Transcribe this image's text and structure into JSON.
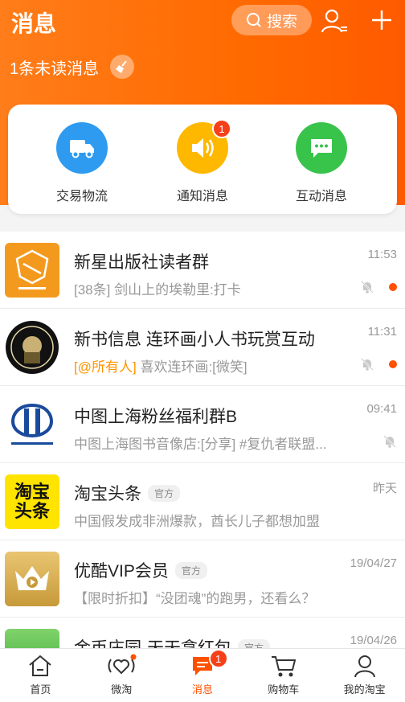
{
  "header": {
    "title": "消息",
    "search_label": "搜索",
    "unread_text": "1条未读消息",
    "brand_color": "#ff6a00"
  },
  "categories": [
    {
      "label": "交易物流",
      "icon": "truck-icon",
      "color": "#2e9bf0"
    },
    {
      "label": "通知消息",
      "icon": "speaker-icon",
      "color": "#ffb800",
      "badge": "1"
    },
    {
      "label": "互动消息",
      "icon": "chat-icon",
      "color": "#38c34b"
    }
  ],
  "messages": [
    {
      "name": "新星出版社读者群",
      "time": "11:53",
      "preview": "[38条] 剑山上的埃勒里:打卡",
      "muted": true,
      "unread_dot": true
    },
    {
      "name": "新书信息 连环画小人书玩赏互动",
      "time": "11:31",
      "mention": "[@所有人]",
      "preview": " 喜欢连环画:[微笑]",
      "muted": true,
      "unread_dot": true
    },
    {
      "name": "中图上海粉丝福利群B",
      "time": "09:41",
      "preview": "中图上海图书音像店:[分享] #复仇者联盟...",
      "muted": true,
      "unread_dot": false
    },
    {
      "name": "淘宝头条",
      "tag": "官方",
      "time": "昨天",
      "preview": "中国假发成非洲爆款，酋长儿子都想加盟"
    },
    {
      "name": "优酷VIP会员",
      "tag": "官方",
      "time": "19/04/27",
      "preview": "【限时折扣】“没团魂”的跑男，还看么？"
    },
    {
      "name": "金币庄园-天天拿红包",
      "tag": "官方",
      "time": "19/04/26",
      "preview": ""
    }
  ],
  "avatars": {
    "taobao_line1": "淘宝",
    "taobao_line2": "头条"
  },
  "tabbar": [
    {
      "label": "首页",
      "icon": "home-icon"
    },
    {
      "label": "微淘",
      "icon": "heart-wave-icon"
    },
    {
      "label": "消息",
      "icon": "message-icon",
      "badge": "1",
      "active": true
    },
    {
      "label": "购物车",
      "icon": "cart-icon"
    },
    {
      "label": "我的淘宝",
      "icon": "profile-icon"
    }
  ]
}
